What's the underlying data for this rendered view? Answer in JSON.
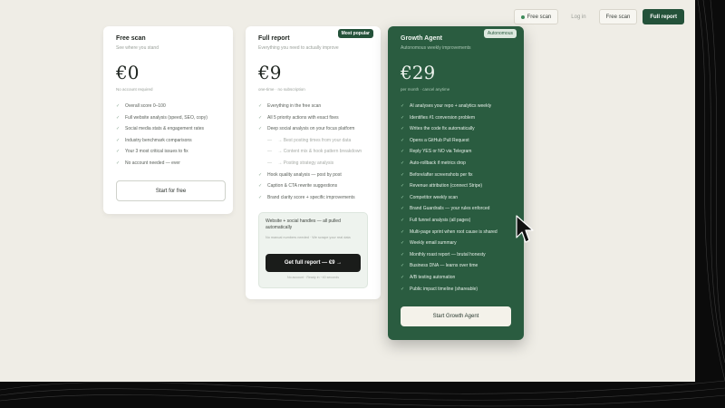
{
  "nav": {
    "free_scan_badge": "Free scan",
    "login": "Log in",
    "free_scan": "Free scan",
    "full_report": "Full report"
  },
  "plans": {
    "free": {
      "name": "Free scan",
      "tagline": "See where you stand",
      "price": "€0",
      "price_note": "No account required",
      "features": [
        "Overall score 0–100",
        "Full website analysis (speed, SEO, copy)",
        "Social media stats & engagement rates",
        "Industry benchmark comparisons",
        "Your 3 most critical issues to fix",
        "No account needed — ever"
      ],
      "button": "Start for free"
    },
    "full": {
      "name": "Full report",
      "tagline": "Everything you need to actually improve",
      "badge": "Most popular",
      "price": "€9",
      "price_note": "one-time · no subscription",
      "features": [
        "Everything in the free scan",
        "All 5 priority actions with exact fixes",
        "Deep social analysis on your focus platform"
      ],
      "sub_features": [
        "→ Best posting times from your data",
        "→ Content mix & hook pattern breakdown",
        "→ Posting strategy analysis"
      ],
      "features_more": [
        "Hook quality analysis — post by post",
        "Caption & CTA rewrite suggestions",
        "Brand clarity score + specific improvements"
      ],
      "cta_title": "Website + social handles — all pulled automatically",
      "cta_sub": "No manual numbers needed · We scrape your real data",
      "button": "Get full report — €9 →",
      "cta_foot": "No account · Ready in ~40 seconds"
    },
    "growth": {
      "name": "Growth Agent",
      "tagline": "Autonomous weekly improvements",
      "badge": "Autonomous",
      "price": "€29",
      "price_note": "per month · cancel anytime",
      "features": [
        "AI analyses your repo + analytics weekly",
        "Identifies #1 conversion problem",
        "Writes the code fix automatically",
        "Opens a GitHub Pull Request",
        "Reply YES or NO via Telegram",
        "Auto-rollback if metrics drop",
        "Before/after screenshots per fix",
        "Revenue attribution (connect Stripe)",
        "Competitor weekly scan",
        "Brand Guardrails — your rules enforced",
        "Full funnel analysis (all pages)",
        "Multi-page sprint when root cause is shared",
        "Weekly email summary",
        "Monthly roast report — brutal honesty",
        "Business DNA — learns over time",
        "A/B testing automation",
        "Public impact timeline (shareable)"
      ],
      "button": "Start Growth Agent"
    }
  },
  "colors": {
    "accent_green": "#2a5c40",
    "dark_button": "#1a1c1a",
    "page_bg": "#efede6"
  }
}
